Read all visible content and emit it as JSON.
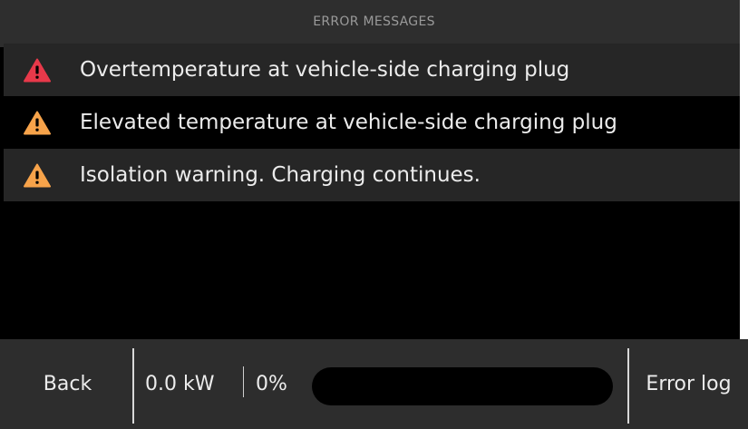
{
  "header": {
    "title": "ERROR MESSAGES"
  },
  "messages": [
    {
      "text": "Overtemperature at vehicle-side charging plug",
      "severity": "error",
      "icon": "warning-triangle-icon",
      "icon_color": "#e8394a"
    },
    {
      "text": "Elevated temperature at vehicle-side charging plug",
      "severity": "warning",
      "icon": "warning-triangle-icon",
      "icon_color": "#f7a34a"
    },
    {
      "text": "Isolation warning. Charging continues.",
      "severity": "warning",
      "icon": "warning-triangle-icon",
      "icon_color": "#f7a34a"
    }
  ],
  "footer": {
    "back_label": "Back",
    "power": "0.0 kW",
    "percent": "0%",
    "progress": 0,
    "error_log_label": "Error log"
  }
}
